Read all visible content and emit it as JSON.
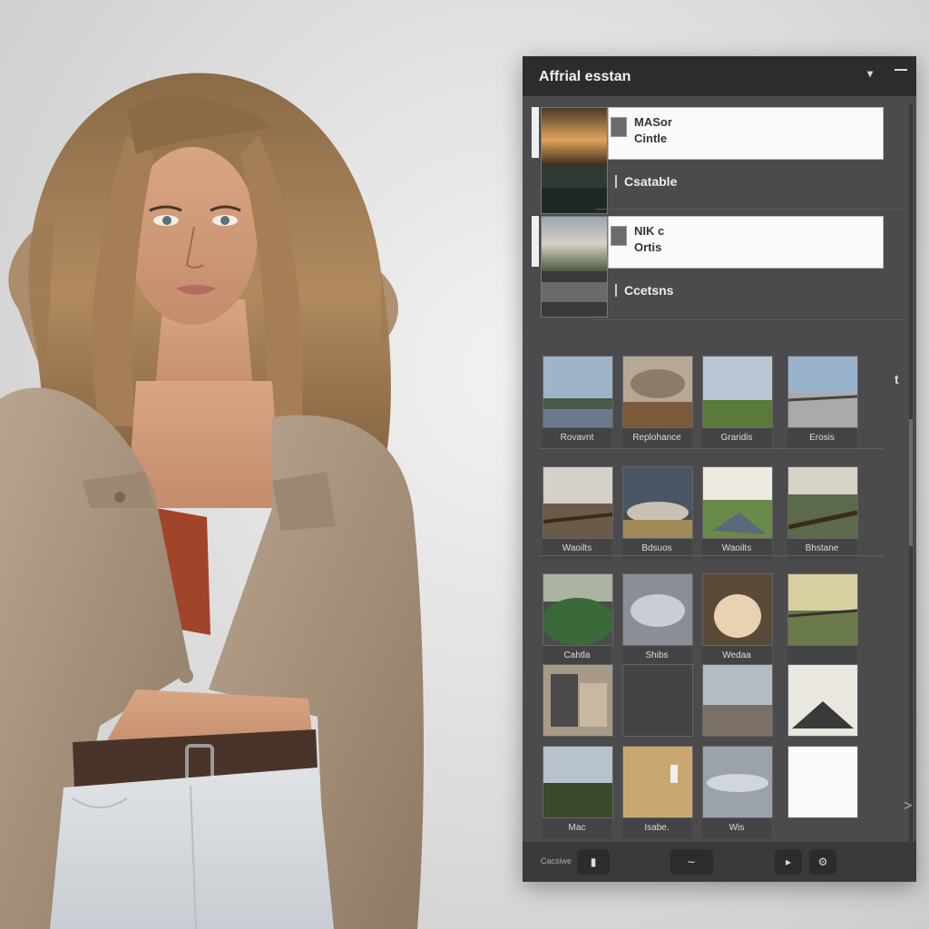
{
  "panel": {
    "title": "Affrial esstan",
    "collapse_icon": "chevron-down-icon",
    "minimize_icon": "minimize-icon",
    "items": [
      {
        "line1": "MASor",
        "line2": "Cintle",
        "sub": "Csatable"
      },
      {
        "line1": "NIK c",
        "line2": "Ortis",
        "sub": "Ccetsns"
      }
    ],
    "grid": [
      [
        "Rovavnt",
        "Replohance",
        "Graridis",
        "Erosis"
      ],
      [
        "Waoilts",
        "Bdsuos",
        "Waoilts",
        "Bhstane"
      ],
      [
        "Cahtla",
        "Shibs",
        "Wedaa",
        ""
      ],
      [
        "",
        "",
        "",
        ""
      ],
      [
        "Mac",
        "Isabe.",
        "Wis",
        ""
      ]
    ],
    "side_marker": "t",
    "side_chevron": ">",
    "footer": {
      "label": "Cacsiwe",
      "button_icons": [
        "folder-icon",
        "link-icon",
        "play-icon",
        "settings-icon"
      ]
    }
  }
}
